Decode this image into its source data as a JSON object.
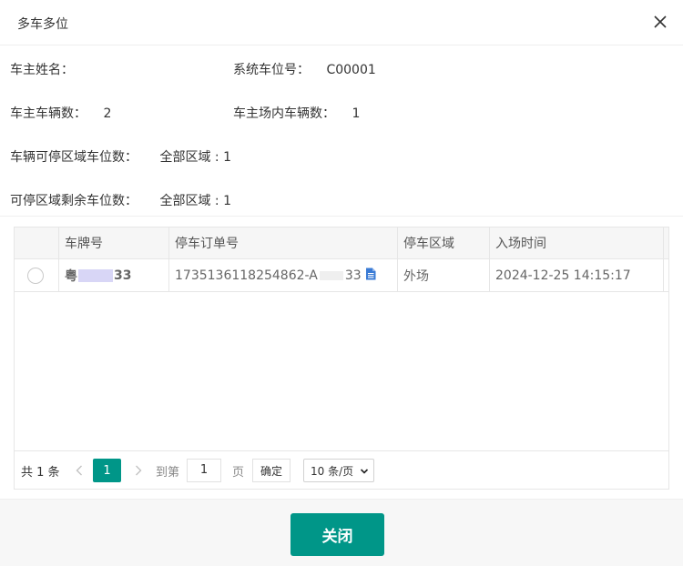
{
  "dialog": {
    "title": "多车多位",
    "close_label": "关闭"
  },
  "info": {
    "owner_name_label": "车主姓名：",
    "owner_name_value": "",
    "system_space_label": "系统车位号：",
    "system_space_value": "C00001",
    "owner_vehicles_label": "车主车辆数：",
    "owner_vehicles_value": "2",
    "vehicles_in_lot_label": "车主场内车辆数：",
    "vehicles_in_lot_value": "1",
    "area_spaces_label": "车辆可停区域车位数：",
    "area_spaces_value": "全部区域 : 1",
    "remaining_spaces_label": "可停区域剩余车位数：",
    "remaining_spaces_value": "全部区域 : 1"
  },
  "table": {
    "columns": [
      "车牌号",
      "停车订单号",
      "停车区域",
      "入场时间"
    ],
    "rows": [
      {
        "plate_prefix": "粤",
        "plate_suffix": "33",
        "order_prefix": "1735136118254862-A",
        "order_suffix": "33",
        "area": "外场",
        "entry_time": "2024-12-25 14:15:17"
      }
    ]
  },
  "pagination": {
    "total": "共 1 条",
    "current_page": "1",
    "goto_label": "到第",
    "goto_value": "1",
    "page_unit": "页",
    "confirm": "确定",
    "page_size": "10 条/页"
  },
  "icons": {
    "close": "close-icon",
    "document": "document-icon",
    "prev": "chevron-left-icon",
    "next": "chevron-right-icon"
  },
  "colors": {
    "primary": "#009688",
    "plate": "#2d4fc7",
    "doc_icon": "#3a7bd5"
  }
}
